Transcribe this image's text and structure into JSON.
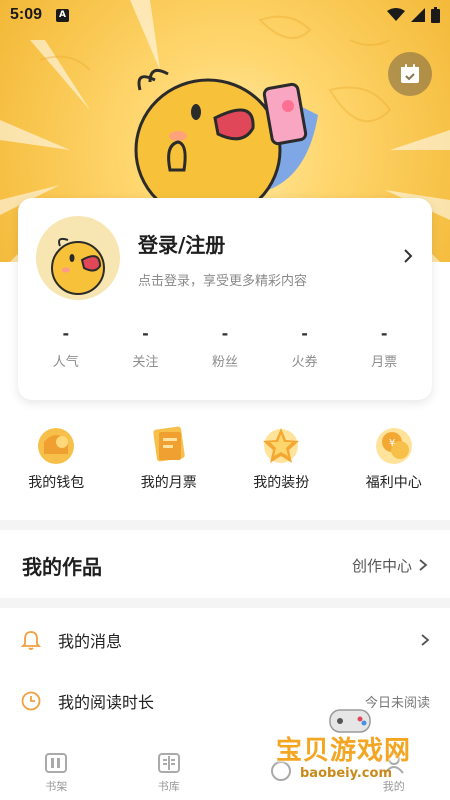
{
  "status_bar": {
    "time": "5:09",
    "indicator": "A"
  },
  "profile": {
    "login_title": "登录/注册",
    "login_subtitle": "点击登录，享受更多精彩内容",
    "stats": [
      {
        "value": "-",
        "label": "人气"
      },
      {
        "value": "-",
        "label": "关注"
      },
      {
        "value": "-",
        "label": "粉丝"
      },
      {
        "value": "-",
        "label": "火券"
      },
      {
        "value": "-",
        "label": "月票"
      }
    ]
  },
  "quick_actions": [
    {
      "label": "我的钱包",
      "icon": "wallet-icon"
    },
    {
      "label": "我的月票",
      "icon": "monthly-ticket-icon"
    },
    {
      "label": "我的装扮",
      "icon": "dressup-star-icon"
    },
    {
      "label": "福利中心",
      "icon": "welfare-coin-icon"
    }
  ],
  "works": {
    "title": "我的作品",
    "link": "创作中心"
  },
  "menu": [
    {
      "label": "我的消息",
      "icon": "bell-icon",
      "right": ""
    },
    {
      "label": "我的阅读时长",
      "icon": "clock-icon",
      "right": "今日未阅读"
    }
  ],
  "bottom_nav": [
    {
      "label": "书架",
      "icon": "bookshelf-icon"
    },
    {
      "label": "书库",
      "icon": "library-icon"
    },
    {
      "label": "",
      "icon": "discover-icon"
    },
    {
      "label": "我的",
      "icon": "profile-icon"
    }
  ],
  "watermark": {
    "text": "宝贝游戏网",
    "url": "baobeiy.com"
  },
  "colors": {
    "accent": "#f4a623",
    "header_bg": "#f8c44b",
    "icon_orange": "#f0a040"
  }
}
